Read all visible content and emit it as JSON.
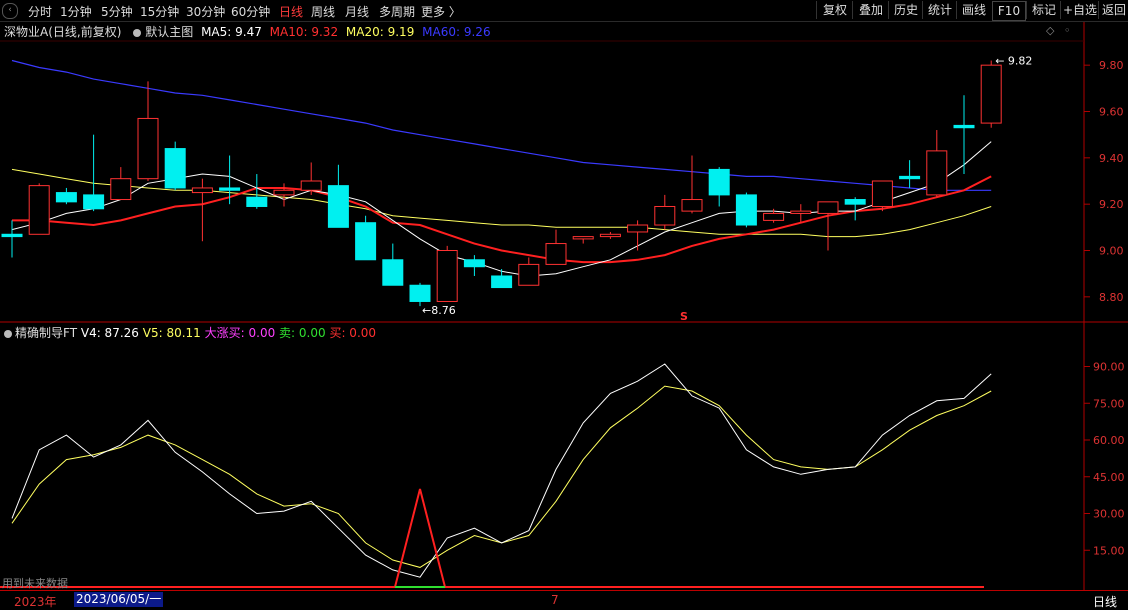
{
  "tabs": [
    {
      "label": "分时",
      "active": false
    },
    {
      "label": "1分钟",
      "active": false
    },
    {
      "label": "5分钟",
      "active": false
    },
    {
      "label": "15分钟",
      "active": false
    },
    {
      "label": "30分钟",
      "active": false
    },
    {
      "label": "60分钟",
      "active": false
    },
    {
      "label": "日线",
      "active": true
    },
    {
      "label": "周线",
      "active": false
    },
    {
      "label": "月线",
      "active": false
    },
    {
      "label": "多周期",
      "active": false
    },
    {
      "label": "更多 〉",
      "active": false
    }
  ],
  "tools": [
    "复权",
    "叠加",
    "历史",
    "统计",
    "画线",
    "F10",
    "标记",
    "+自选",
    "返回"
  ],
  "main_info": {
    "title": "深物业A(日线,前复权)",
    "template": "默认主图",
    "ma5": "MA5: 9.47",
    "ma10": "MA10: 9.32",
    "ma20": "MA20: 9.19",
    "ma60": "MA60: 9.26"
  },
  "ind_info": {
    "name": "精确制导FT",
    "v4": "V4: 87.26",
    "v5": "V5: 80.11",
    "dzm": "大涨买: 0.00",
    "sell": "卖: 0.00",
    "buy": "买: 0.00"
  },
  "price_axis": [
    "9.80",
    "9.60",
    "9.40",
    "9.20",
    "9.00",
    "8.80"
  ],
  "ind_axis": [
    "90.00",
    "75.00",
    "60.00",
    "45.00",
    "30.00",
    "15.00"
  ],
  "high_label": "9.82",
  "low_label": "8.76",
  "signal_label": "S",
  "future_note": "用到未来数据",
  "date_bar": {
    "year": "2023年",
    "date": "2023/06/05/一",
    "month": "7",
    "period": "日线"
  },
  "colors": {
    "up": "#ff3232",
    "down": "#00f0f0",
    "ma5": "#ffffff",
    "ma10": "#ff2020",
    "ma20": "#ffff60",
    "ma60": "#3a3aff"
  },
  "chart_data": {
    "type": "candlestick",
    "price_range": [
      8.7,
      9.9
    ],
    "candles": [
      {
        "o": 9.07,
        "c": 9.06,
        "h": 9.13,
        "l": 8.97
      },
      {
        "o": 9.07,
        "c": 9.28,
        "h": 9.29,
        "l": 9.07
      },
      {
        "o": 9.25,
        "c": 9.21,
        "h": 9.27,
        "l": 9.2
      },
      {
        "o": 9.24,
        "c": 9.18,
        "h": 9.5,
        "l": 9.17
      },
      {
        "o": 9.22,
        "c": 9.31,
        "h": 9.36,
        "l": 9.22
      },
      {
        "o": 9.31,
        "c": 9.57,
        "h": 9.73,
        "l": 9.3
      },
      {
        "o": 9.44,
        "c": 9.27,
        "h": 9.47,
        "l": 9.26
      },
      {
        "o": 9.25,
        "c": 9.27,
        "h": 9.31,
        "l": 9.04
      },
      {
        "o": 9.27,
        "c": 9.26,
        "h": 9.41,
        "l": 9.2
      },
      {
        "o": 9.23,
        "c": 9.19,
        "h": 9.33,
        "l": 9.18
      },
      {
        "o": 9.24,
        "c": 9.26,
        "h": 9.29,
        "l": 9.19
      },
      {
        "o": 9.26,
        "c": 9.3,
        "h": 9.38,
        "l": 9.24
      },
      {
        "o": 9.28,
        "c": 9.1,
        "h": 9.37,
        "l": 9.1
      },
      {
        "o": 9.12,
        "c": 8.96,
        "h": 9.15,
        "l": 8.96
      },
      {
        "o": 8.96,
        "c": 8.85,
        "h": 9.03,
        "l": 8.85
      },
      {
        "o": 8.85,
        "c": 8.78,
        "h": 8.86,
        "l": 8.76
      },
      {
        "o": 8.78,
        "c": 9.0,
        "h": 9.02,
        "l": 8.78
      },
      {
        "o": 8.96,
        "c": 8.93,
        "h": 8.98,
        "l": 8.89
      },
      {
        "o": 8.89,
        "c": 8.84,
        "h": 8.92,
        "l": 8.84
      },
      {
        "o": 8.85,
        "c": 8.94,
        "h": 8.97,
        "l": 8.85
      },
      {
        "o": 8.94,
        "c": 9.03,
        "h": 9.09,
        "l": 8.94
      },
      {
        "o": 9.05,
        "c": 9.06,
        "h": 9.06,
        "l": 9.03
      },
      {
        "o": 9.06,
        "c": 9.07,
        "h": 9.08,
        "l": 9.05
      },
      {
        "o": 9.08,
        "c": 9.11,
        "h": 9.13,
        "l": 9.0
      },
      {
        "o": 9.11,
        "c": 9.19,
        "h": 9.24,
        "l": 9.09
      },
      {
        "o": 9.17,
        "c": 9.22,
        "h": 9.41,
        "l": 9.16
      },
      {
        "o": 9.35,
        "c": 9.24,
        "h": 9.36,
        "l": 9.19
      },
      {
        "o": 9.24,
        "c": 9.11,
        "h": 9.25,
        "l": 9.1
      },
      {
        "o": 9.13,
        "c": 9.16,
        "h": 9.18,
        "l": 9.12
      },
      {
        "o": 9.16,
        "c": 9.17,
        "h": 9.2,
        "l": 9.12
      },
      {
        "o": 9.16,
        "c": 9.21,
        "h": 9.21,
        "l": 9.0
      },
      {
        "o": 9.22,
        "c": 9.2,
        "h": 9.23,
        "l": 9.13
      },
      {
        "o": 9.19,
        "c": 9.3,
        "h": 9.3,
        "l": 9.17
      },
      {
        "o": 9.32,
        "c": 9.31,
        "h": 9.39,
        "l": 9.27
      },
      {
        "o": 9.24,
        "c": 9.43,
        "h": 9.52,
        "l": 9.23
      },
      {
        "o": 9.54,
        "c": 9.53,
        "h": 9.67,
        "l": 9.33
      },
      {
        "o": 9.55,
        "c": 9.8,
        "h": 9.82,
        "l": 9.53
      }
    ],
    "ma5": [
      9.09,
      9.12,
      9.16,
      9.18,
      9.22,
      9.29,
      9.31,
      9.33,
      9.32,
      9.27,
      9.22,
      9.26,
      9.24,
      9.21,
      9.13,
      9.05,
      8.98,
      8.95,
      8.91,
      8.89,
      8.9,
      8.93,
      8.96,
      9.02,
      9.08,
      9.12,
      9.16,
      9.17,
      9.17,
      9.16,
      9.17,
      9.17,
      9.21,
      9.25,
      9.29,
      9.37,
      9.47
    ],
    "ma10": [
      9.13,
      9.13,
      9.12,
      9.11,
      9.13,
      9.16,
      9.19,
      9.2,
      9.23,
      9.27,
      9.27,
      9.26,
      9.23,
      9.19,
      9.12,
      9.11,
      9.07,
      9.03,
      9.0,
      8.98,
      8.96,
      8.95,
      8.95,
      8.96,
      8.98,
      9.02,
      9.05,
      9.07,
      9.09,
      9.12,
      9.15,
      9.17,
      9.18,
      9.2,
      9.23,
      9.26,
      9.32
    ],
    "ma20": [
      9.35,
      9.33,
      9.31,
      9.29,
      9.28,
      9.27,
      9.26,
      9.26,
      9.25,
      9.24,
      9.23,
      9.22,
      9.2,
      9.18,
      9.15,
      9.14,
      9.13,
      9.12,
      9.11,
      9.11,
      9.1,
      9.1,
      9.1,
      9.1,
      9.09,
      9.08,
      9.07,
      9.07,
      9.07,
      9.07,
      9.06,
      9.06,
      9.07,
      9.09,
      9.12,
      9.15,
      9.19
    ],
    "ma60": [
      9.82,
      9.79,
      9.77,
      9.74,
      9.72,
      9.7,
      9.68,
      9.67,
      9.65,
      9.63,
      9.61,
      9.59,
      9.57,
      9.55,
      9.52,
      9.5,
      9.48,
      9.46,
      9.44,
      9.42,
      9.4,
      9.38,
      9.37,
      9.36,
      9.35,
      9.34,
      9.33,
      9.32,
      9.32,
      9.31,
      9.3,
      9.29,
      9.28,
      9.27,
      9.26,
      9.26,
      9.26
    ],
    "indicator_range": [
      0,
      100
    ],
    "v4": [
      28,
      56,
      62,
      53,
      58,
      68,
      55,
      47,
      38,
      30,
      31,
      35,
      24,
      13,
      7,
      4,
      20,
      24,
      18,
      23,
      48,
      67,
      79,
      84,
      91,
      78,
      73,
      56,
      49,
      46,
      48,
      49,
      62,
      70,
      76,
      77,
      87
    ],
    "v5": [
      26,
      42,
      52,
      54,
      57,
      62,
      58,
      52,
      46,
      38,
      33,
      34,
      30,
      18,
      11,
      8,
      15,
      21,
      18,
      21,
      35,
      52,
      65,
      73,
      82,
      80,
      74,
      62,
      52,
      49,
      48,
      49,
      56,
      64,
      70,
      74,
      80
    ],
    "signal_triangle": {
      "index": 15,
      "peak": 40
    },
    "sell_zero_line": 0
  }
}
